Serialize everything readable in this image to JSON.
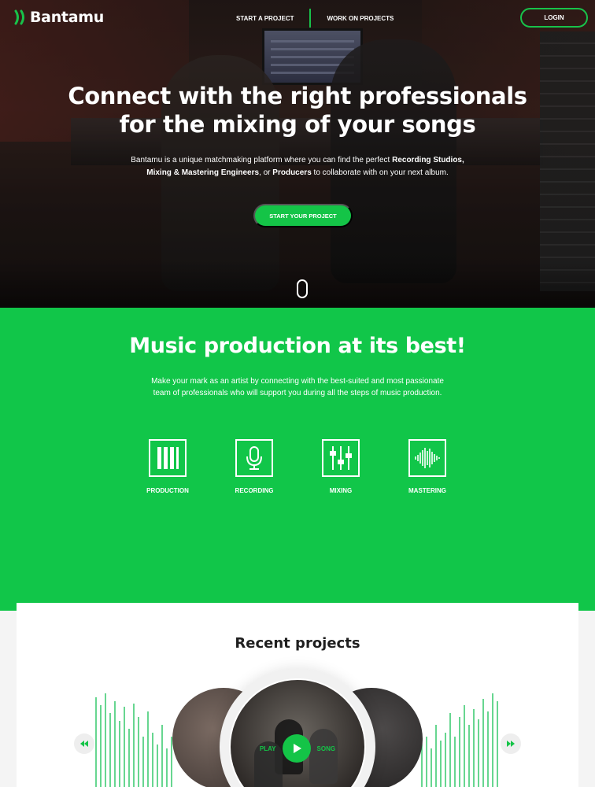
{
  "brand": {
    "name": "Bantamu",
    "accent": "#14c447"
  },
  "nav": {
    "start_project": "START A PROJECT",
    "work_on_projects": "WORK ON PROJECTS",
    "login": "LOGIN"
  },
  "hero": {
    "title_line1": "Connect with the right professionals",
    "title_line2": "for the mixing of your songs",
    "desc_part1": "Bantamu is a unique matchmaking platform where you can find the perfect ",
    "desc_bold1": "Recording Studios,",
    "desc_bold2": "Mixing & Mastering Engineers",
    "desc_part2": ", or ",
    "desc_bold3": "Producers",
    "desc_part3": " to collaborate with on your next album.",
    "cta": "START YOUR PROJECT"
  },
  "production": {
    "title": "Music production at its best!",
    "desc": "Make your mark as an artist by connecting with the best-suited and most passionate team of professionals who will support you during all the steps of music production.",
    "services": [
      {
        "label": "PRODUCTION",
        "icon": "piano-keys-icon"
      },
      {
        "label": "RECORDING",
        "icon": "microphone-icon"
      },
      {
        "label": "MIXING",
        "icon": "mixer-sliders-icon"
      },
      {
        "label": "MASTERING",
        "icon": "waveform-icon"
      }
    ]
  },
  "recent": {
    "title": "Recent projects",
    "play_label": "PLAY",
    "song_label": "SONG"
  }
}
